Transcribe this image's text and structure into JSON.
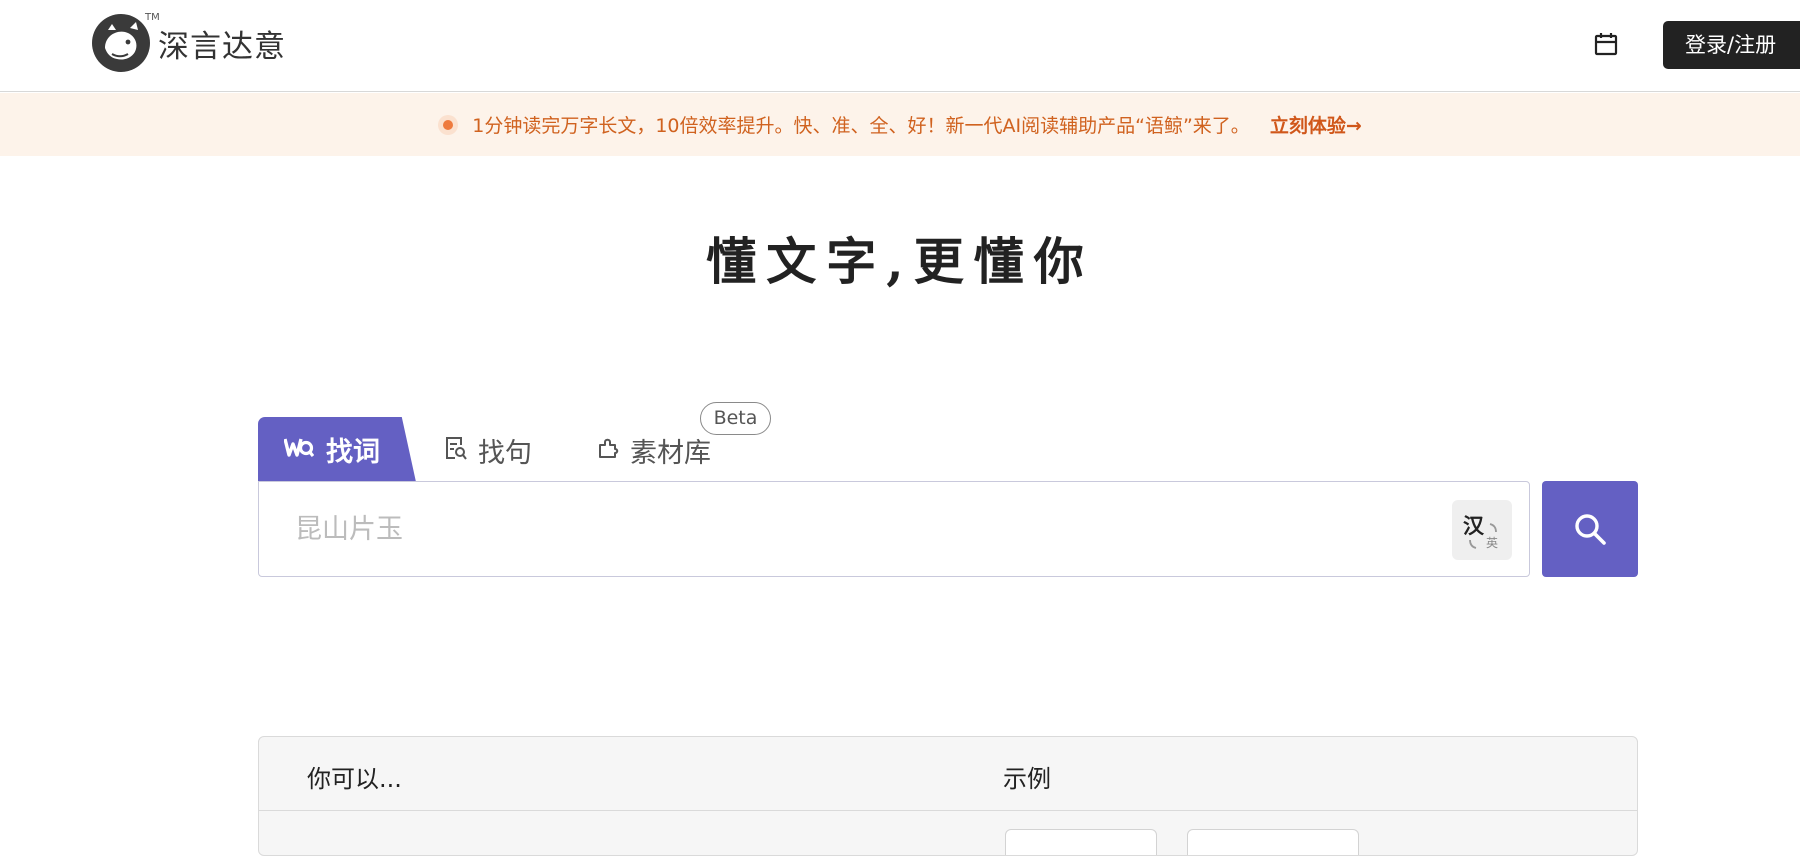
{
  "header": {
    "brand": "深言达意",
    "trademark": "TM",
    "login_label": "登录/注册"
  },
  "banner": {
    "message": "1分钟读完万字长文，10倍效率提升。快、准、全、好！新一代AI阅读辅助产品“语鲸”来了。",
    "cta": "立刻体验→"
  },
  "hero": {
    "slogan": "懂文字,更懂你"
  },
  "search": {
    "tabs": [
      {
        "label": "找词",
        "icon": "wq-logo-icon",
        "active": true
      },
      {
        "label": "找句",
        "icon": "sentence-search-icon",
        "active": false
      },
      {
        "label": "素材库",
        "icon": "puzzle-icon",
        "active": false
      }
    ],
    "beta_badge": "Beta",
    "placeholder": "昆山片玉",
    "lang_toggle": {
      "primary": "汉",
      "secondary": "英"
    }
  },
  "hints": {
    "col1_header": "你可以...",
    "col2_header": "示例"
  },
  "colors": {
    "accent": "#6460c3",
    "banner_bg": "#fdf3ea",
    "banner_text": "#d0621f",
    "dark_button": "#222222"
  }
}
